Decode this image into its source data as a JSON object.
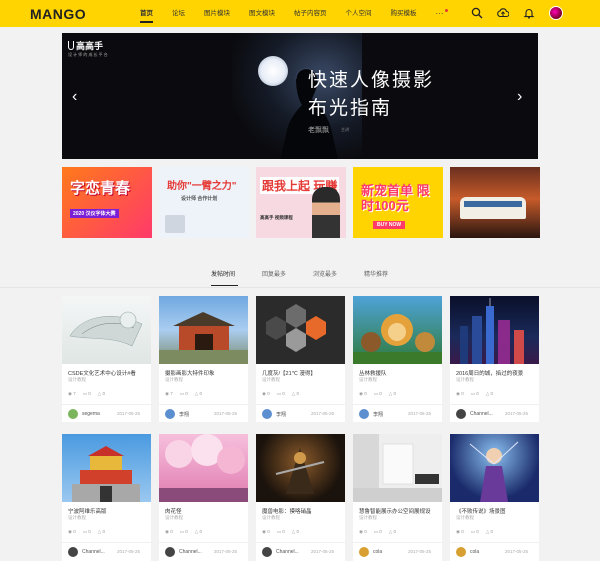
{
  "header": {
    "logo": "MANGO",
    "nav": [
      {
        "label": "首页",
        "active": true
      },
      {
        "label": "论坛"
      },
      {
        "label": "图片模块"
      },
      {
        "label": "图文模块"
      },
      {
        "label": "帖子内容页"
      },
      {
        "label": "个人空间"
      },
      {
        "label": "购买模板"
      },
      {
        "label": "···"
      }
    ],
    "icons": [
      "search-icon",
      "upload-icon",
      "bell-icon"
    ],
    "accent_color": "#ffd400"
  },
  "banner": {
    "brand_name": "高高手",
    "brand_tagline": "设 计 师 的 成 长 平 台",
    "title_line1": "快速人像摄影",
    "title_line2": "布光指南",
    "author": "老飘飘",
    "author_tag": "主讲",
    "prev_arrow": "‹",
    "next_arrow": "›"
  },
  "promos": [
    {
      "text": "字恋青春",
      "sub": "2020 汉仪字体大赛"
    },
    {
      "text": "助你\"一臂之力\"",
      "sub": "设计师 合作计划"
    },
    {
      "text": "跟我上起 玩赚",
      "sub": "高高手 视频课程"
    },
    {
      "text": "新宠首单 限时100元",
      "sub": "BUY NOW"
    },
    {
      "text": "",
      "sub": ""
    }
  ],
  "tabs": [
    {
      "label": "发帖时间",
      "active": true
    },
    {
      "label": "回复最多"
    },
    {
      "label": "浏览最多"
    },
    {
      "label": "精华推荐"
    }
  ],
  "cards": [
    {
      "title": "CSDE文化艺术中心设计#看",
      "category": "设计教程",
      "views": "7",
      "comments": "0",
      "likes": "0",
      "user": "segema",
      "date": "2017-05-25"
    },
    {
      "title": "摄影画影大特件印象",
      "category": "设计教程",
      "views": "7",
      "comments": "0",
      "likes": "0",
      "user": "李翔",
      "date": "2017-05-25"
    },
    {
      "title": "几度灰/【21℃ 漫得】",
      "category": "设计教程",
      "views": "0",
      "comments": "0",
      "likes": "0",
      "user": "李翔",
      "date": "2017-05-25"
    },
    {
      "title": "丛林救援队",
      "category": "设计教程",
      "views": "0",
      "comments": "0",
      "likes": "0",
      "user": "李翔",
      "date": "2017-05-25"
    },
    {
      "title": "2016周日的城，掐过的夜景",
      "category": "设计教程",
      "views": "0",
      "comments": "0",
      "likes": "0",
      "user": "Channel...",
      "date": "2017-05-25"
    },
    {
      "title": "宁波阿维乐高版",
      "category": "设计教程",
      "views": "0",
      "comments": "0",
      "likes": "0",
      "user": "Channel...",
      "date": "2017-05-25"
    },
    {
      "title": "肉花怪",
      "category": "设计教程",
      "views": "0",
      "comments": "0",
      "likes": "0",
      "user": "Channel...",
      "date": "2017-05-25"
    },
    {
      "title": "魔兽电影：摸咯硝晶",
      "category": "设计教程",
      "views": "0",
      "comments": "0",
      "likes": "0",
      "user": "Channel...",
      "date": "2017-05-25"
    },
    {
      "title": "慧鲁智能展示办公空间展规设",
      "category": "设计教程",
      "views": "0",
      "comments": "0",
      "likes": "0",
      "user": "cola",
      "date": "2017-05-25"
    },
    {
      "title": "《不败传说》场景图",
      "category": "设计教程",
      "views": "0",
      "comments": "0",
      "likes": "0",
      "user": "cola",
      "date": "2017-05-25"
    }
  ]
}
